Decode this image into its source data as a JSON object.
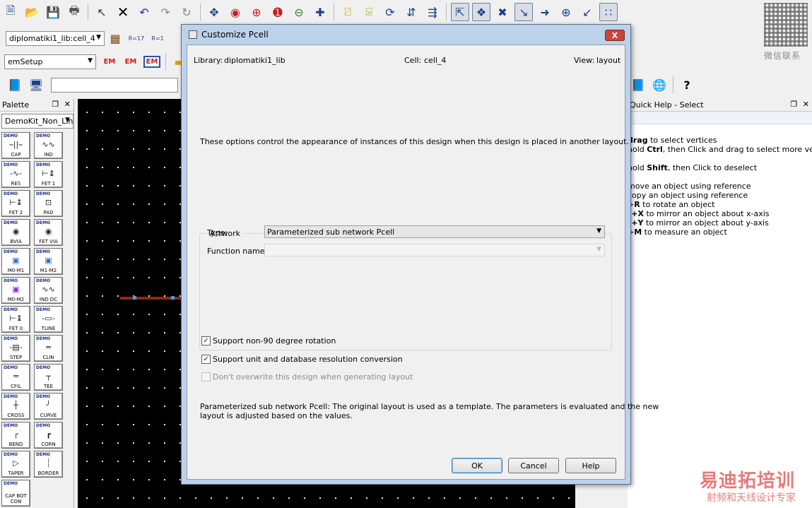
{
  "toolbar1": {
    "icons": [
      "new-file-icon",
      "open-folder-icon",
      "save-icon",
      "print-icon",
      "select-arrow-icon",
      "delete-icon",
      "undo-icon",
      "redo-icon",
      "repeat-icon",
      "move-icon",
      "stop-icon",
      "zoom-in-icon",
      "zoom-2x-icon",
      "zoom-out-icon",
      "pan-icon"
    ]
  },
  "toolbar2": {
    "cell_combo": "diplomatiki1_lib:cell_4",
    "r_label": "R=17",
    "r_label2": "R=1"
  },
  "toolbar3": {
    "setup_combo": "emSetup",
    "em_label": "EM"
  },
  "watermark_qr_text": "微信联系",
  "palette": {
    "title": "Palette",
    "library_combo": "DemoKit_Non_Lin",
    "demo_tag": "DEMO",
    "items": [
      "CAP",
      "IND",
      "RES",
      "FET 1",
      "FET 2",
      "PAD",
      "BVIA",
      "FET VIA",
      "M0-M1",
      "M1-M2",
      "M0-M2",
      "IND DC",
      "FET 0",
      "TLINE",
      "STEP",
      "CLIN",
      "CFIL",
      "TEE",
      "CROSS",
      "CURVE",
      "BEND",
      "CORN",
      "TAPER",
      "BORDER",
      "CAP BOT CON"
    ]
  },
  "quick_help": {
    "title": "Quick Help - Select",
    "lines": [
      {
        "bold": "drag",
        "rest": " to select vertices"
      },
      {
        "bold": "",
        "rest": "hold ",
        "bold2": "Ctrl",
        "rest2": ", then Click and drag to select more vertices"
      },
      {
        "bold": "",
        "rest": "hold ",
        "bold2": "Shift",
        "rest2": ", then Click to deselect"
      },
      {
        "bold": "",
        "rest": " move an object using reference"
      },
      {
        "bold": "",
        "rest": "copy an object using reference"
      },
      {
        "bold": "+R",
        "rest": " to rotate an object"
      },
      {
        "bold": "t+X",
        "rest": " to mirror an object about x-axis"
      },
      {
        "bold": "t+Y",
        "rest": " to mirror an object about y-axis"
      },
      {
        "bold": "+M",
        "rest": " to measure an object"
      }
    ]
  },
  "watermark": {
    "main": "易迪拓培训",
    "sub": "射频和天线设计专家"
  },
  "dialog": {
    "title": "Customize Pcell",
    "library_label": "Library:",
    "library_value": "diplomatiki1_lib",
    "cell_label": "Cell:",
    "cell_value": "cell_4",
    "view_label": "View:",
    "view_value": "layout",
    "intro": "These options control the appearance of instances of this design when this design is placed in another layout.",
    "artwork_group": "Artwork",
    "type_label": "Type:",
    "type_value": "Parameterized sub network Pcell",
    "function_label": "Function name:",
    "function_value": "",
    "checkboxes": [
      {
        "label": "Support non-90 degree rotation",
        "checked": true,
        "enabled": true
      },
      {
        "label": "Support unit and database resolution conversion",
        "checked": true,
        "enabled": true
      },
      {
        "label": "Don't overwrite this design when generating layout",
        "checked": false,
        "enabled": false
      }
    ],
    "description_line1": "Parameterized sub network Pcell: The original layout is used as a template.  The parameters is evaluated and the new",
    "description_line2": "layout is adjusted based on the values.",
    "ok": "OK",
    "cancel": "Cancel",
    "help": "Help",
    "close": "X"
  }
}
